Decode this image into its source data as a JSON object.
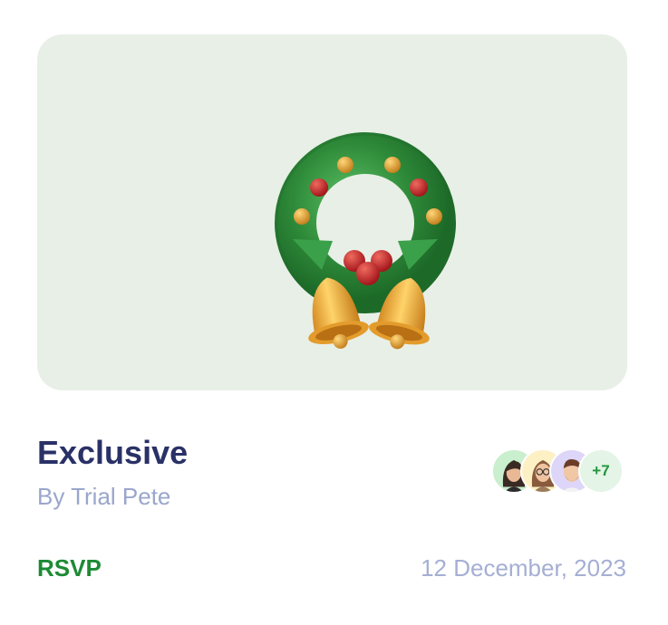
{
  "event": {
    "title": "Exclusive",
    "author": "By Trial Pete",
    "rsvp_label": "RSVP",
    "date": "12 December, 2023"
  },
  "attendees": {
    "avatars": [
      "avatar-woman-dark-hair-icon",
      "avatar-woman-glasses-icon",
      "avatar-man-beard-icon"
    ],
    "more_count": "+7"
  },
  "hero": {
    "icon": "christmas-wreath-bells-icon",
    "background": "#e8efe7"
  },
  "colors": {
    "title": "#293166",
    "muted": "#9aa6cc",
    "accent_green": "#1d8a35"
  }
}
